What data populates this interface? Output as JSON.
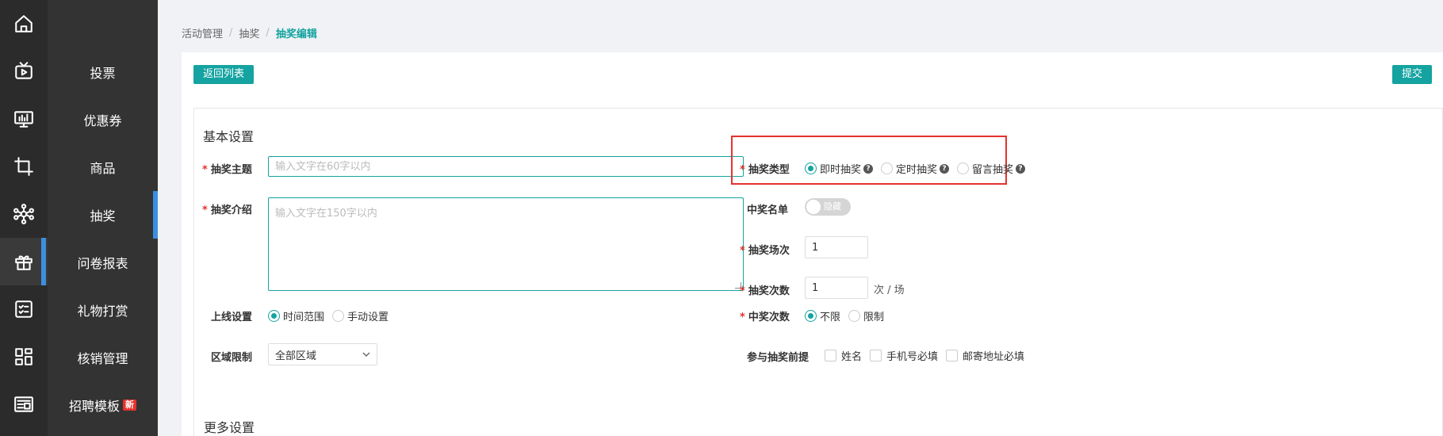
{
  "rail": {
    "items": [
      {
        "icon": "home-icon"
      },
      {
        "icon": "tv-icon"
      },
      {
        "icon": "monitor-chart-icon"
      },
      {
        "icon": "crop-icon"
      },
      {
        "icon": "network-icon"
      },
      {
        "icon": "gift-icon"
      },
      {
        "icon": "checklist-icon"
      },
      {
        "icon": "grid-apps-icon"
      },
      {
        "icon": "newspaper-icon"
      }
    ]
  },
  "submenu": {
    "items": [
      {
        "label": "投票"
      },
      {
        "label": "优惠券"
      },
      {
        "label": "商品"
      },
      {
        "label": "抽奖"
      },
      {
        "label": "问卷报表"
      },
      {
        "label": "礼物打赏"
      },
      {
        "label": "核销管理"
      },
      {
        "label": "招聘模板",
        "badge": "新"
      }
    ]
  },
  "breadcrumb": {
    "items": [
      "活动管理",
      "抽奖",
      "抽奖编辑"
    ],
    "separator": "/"
  },
  "toolbar": {
    "back_label": "返回列表",
    "submit_label": "提交"
  },
  "basic": {
    "title": "基本设置",
    "theme": {
      "label": "抽奖主题",
      "placeholder": "输入文字在60字以内",
      "value": ""
    },
    "intro": {
      "label": "抽奖介绍",
      "placeholder": "输入文字在150字以内",
      "value": ""
    },
    "online": {
      "label": "上线设置",
      "options": [
        "时间范围",
        "手动设置"
      ],
      "selected": "时间范围"
    },
    "region": {
      "label": "区域限制",
      "value": "全部区域"
    },
    "type": {
      "label": "抽奖类型",
      "options": [
        "即时抽奖",
        "定时抽奖",
        "留言抽奖"
      ],
      "selected": "即时抽奖",
      "help": "?"
    },
    "winner_list": {
      "label": "中奖名单",
      "toggle_text": "隐藏",
      "on": false
    },
    "rounds": {
      "label": "抽奖场次",
      "value": "1"
    },
    "times": {
      "label": "抽奖次数",
      "value": "1",
      "unit": "次 / 场"
    },
    "win_times": {
      "label": "中奖次数",
      "options": [
        "不限",
        "限制"
      ],
      "selected": "不限"
    },
    "prereq": {
      "label": "参与抽奖前提",
      "options": [
        "姓名",
        "手机号必填",
        "邮寄地址必填"
      ]
    }
  },
  "more": {
    "title": "更多设置"
  },
  "colors": {
    "accent": "#14a3a0",
    "required": "#e5322d",
    "rail": "#2b2b2b",
    "submenu": "#333333",
    "active_bar": "#3c8fde"
  }
}
